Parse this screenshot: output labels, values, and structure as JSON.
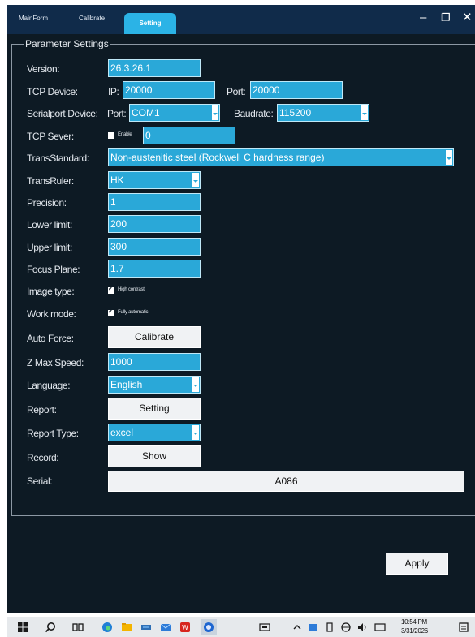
{
  "window": {
    "tabs": [
      "MainForm",
      "Calibrate",
      "Setting"
    ],
    "active_tab": "Setting",
    "controls": {
      "minimize": "–",
      "maximize": "❐",
      "close": "✕"
    }
  },
  "settings": {
    "group_title": "Parameter Settings",
    "version": {
      "label": "Version:",
      "value": "26.3.26.1"
    },
    "tcp_device": {
      "label": "TCP Device:",
      "ip_label": "IP:",
      "ip_value": "20000",
      "port_label": "Port:",
      "port_value": "20000"
    },
    "serial_device": {
      "label": "Serialport Device:",
      "port_label": "Port:",
      "port_value": "COM1",
      "baud_label": "Baudrate:",
      "baud_value": "115200"
    },
    "tcp_server": {
      "label": "TCP Sever:",
      "enable_label": "Enable",
      "value": "0"
    },
    "trans_standard": {
      "label": "TransStandard:",
      "value": "Non-austenitic steel (Rockwell C hardness range)"
    },
    "trans_ruler": {
      "label": "TransRuler:",
      "value": "HK"
    },
    "precision": {
      "label": "Precision:",
      "value": "1"
    },
    "lower_limit": {
      "label": "Lower limit:",
      "value": "200"
    },
    "upper_limit": {
      "label": "Upper limit:",
      "value": "300"
    },
    "focus_plane": {
      "label": "Focus Plane:",
      "value": "1.7"
    },
    "image_type": {
      "label": "Image type:",
      "option": "High contrast"
    },
    "work_mode": {
      "label": "Work mode:",
      "option": "Fully automatic"
    },
    "auto_force": {
      "label": "Auto Force:",
      "button": "Calibrate"
    },
    "z_max_speed": {
      "label": "Z Max Speed:",
      "value": "1000"
    },
    "language": {
      "label": "Language:",
      "value": "English"
    },
    "report": {
      "label": "Report:",
      "button": "Setting"
    },
    "report_type": {
      "label": "Report Type:",
      "value": "excel"
    },
    "record": {
      "label": "Record:",
      "button": "Show"
    },
    "serial": {
      "label": "Serial:",
      "value": "A086"
    }
  },
  "apply_button": "Apply",
  "taskbar": {
    "time": "10:54 PM",
    "date": "3/31/2026",
    "colors": {
      "edge": "#1f7fd6",
      "explorer": "#f4b400",
      "wps": "#d7261e",
      "active_app": "#1e66d0"
    }
  }
}
